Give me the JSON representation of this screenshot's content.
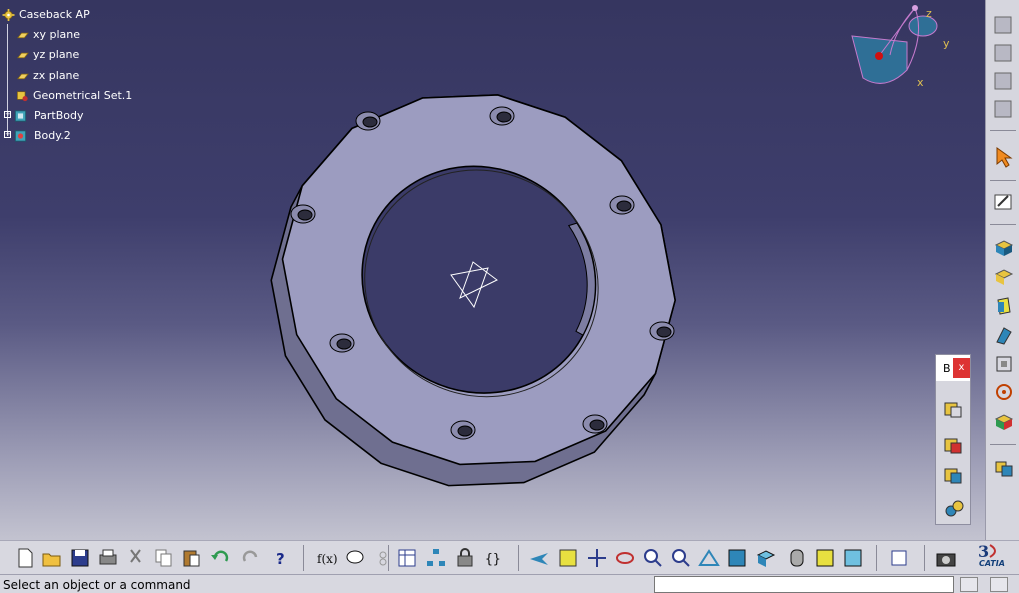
{
  "tree": {
    "root": "Caseback AP",
    "items": [
      {
        "label": "xy plane",
        "icon": "plane-icon"
      },
      {
        "label": "yz plane",
        "icon": "plane-icon"
      },
      {
        "label": "zx plane",
        "icon": "plane-icon"
      },
      {
        "label": "Geometrical Set.1",
        "icon": "geometrical-set-icon"
      },
      {
        "label": "PartBody",
        "icon": "partbody-icon"
      },
      {
        "label": "Body.2",
        "icon": "body-icon"
      }
    ]
  },
  "compass": {
    "x": "x",
    "y": "y",
    "z": "z"
  },
  "float_toolbar": {
    "title": "B",
    "close": "x"
  },
  "statusbar": {
    "text": "Select an object or a command",
    "input_value": ""
  },
  "logo": {
    "text": "CATIA"
  },
  "colors": {
    "viewport_top": "#363660",
    "viewport_bottom": "#c3c3d0",
    "part_face": "#9c9cc0",
    "compass_fill": "#2f6f96"
  }
}
